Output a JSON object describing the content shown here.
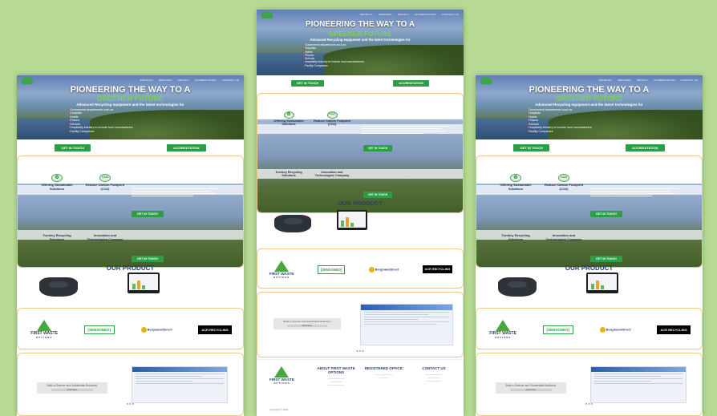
{
  "nav": [
    "PRODUCT",
    "SERVICES",
    "PRIVACY",
    "ACCREDITATION",
    "CONTACT US"
  ],
  "hero": {
    "title": "PIONEERING THE WAY TO A",
    "subtitle": "GREENER FUTURE",
    "tagline": "Advanced Recycling equipment and the latest technologies for",
    "bullets": [
      "Government departments such as",
      "Hospitals",
      "Hotels",
      "Prisons",
      "Schools",
      "Hospitality industry to include food manufacturers",
      "Facility Companies"
    ]
  },
  "buttons": {
    "get_in_touch": "GET IN TOUCH",
    "accreditation": "ACCREDITATION"
  },
  "features": [
    {
      "label": "Offering Sustainable Solutions",
      "icon": "recycle-icon"
    },
    {
      "label": "Reduce Carbon Footprint (CO2)",
      "icon": "co2-icon"
    },
    {
      "label": "Turnkey Recycling Solutions",
      "icon": "recycle-icon"
    },
    {
      "label": "Innovation and Technologies Company",
      "icon": "gear-icon"
    }
  ],
  "product": {
    "title": "OUR PRODUCT"
  },
  "partners": {
    "fwo_name": "FIRST WASTE",
    "fwo_sub": "OPTIONS",
    "sensoneo": "[SENSONEO]",
    "bergmann": "BergmannDirect",
    "acr": "ACR RECYCLING"
  },
  "website": {
    "quote": "Build a Greener and Sustainable Business!",
    "quote_btn": "Read More"
  },
  "footer": {
    "about_title": "ABOUT FIRST WASTE OPTIONS",
    "office_title": "REGISTERED OFFICE:",
    "contact_title": "CONTACT US",
    "copyright": "Copyright © 2022"
  },
  "colors": {
    "background": "#b7db94",
    "accent_green": "#2f9d47",
    "bullet_red": "#e13a3a",
    "navy": "#2c3f6b"
  }
}
